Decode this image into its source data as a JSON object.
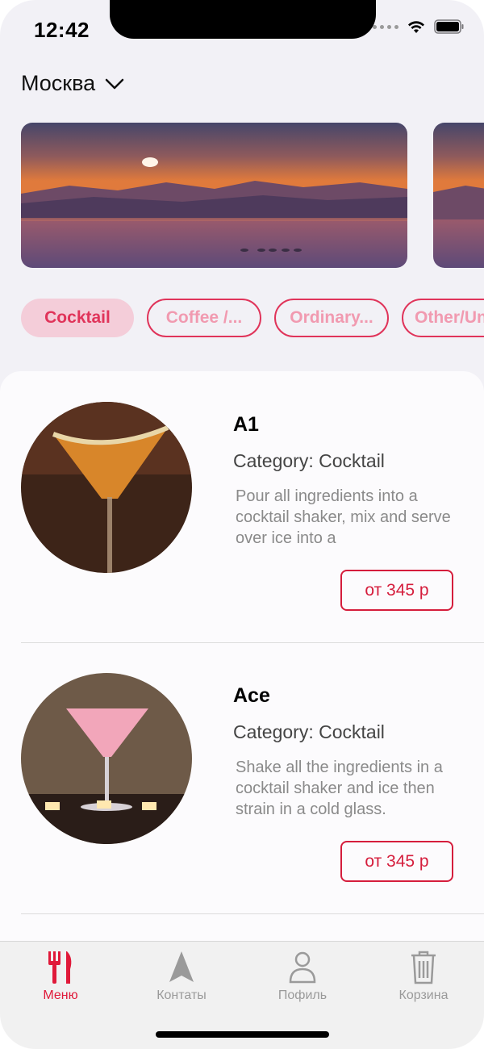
{
  "status": {
    "time": "12:42"
  },
  "location": {
    "city": "Москва"
  },
  "categories": [
    {
      "label": "Cocktail",
      "active": true
    },
    {
      "label": "Coffee /...",
      "active": false
    },
    {
      "label": "Ordinary...",
      "active": false
    },
    {
      "label": "Other/Un",
      "active": false
    }
  ],
  "items": [
    {
      "title": "A1",
      "category": "Category: Cocktail",
      "description": "Pour all ingredients into a cocktail shaker, mix and serve over ice into a",
      "price": "от 345 р"
    },
    {
      "title": "Ace",
      "category": "Category: Cocktail",
      "description": "Shake all the ingredients in a cocktail shaker and ice then strain in a cold glass.",
      "price": "от 345 р"
    }
  ],
  "tabs": [
    {
      "label": "Меню",
      "icon": "fork-knife-icon",
      "active": true
    },
    {
      "label": "Контаты",
      "icon": "navigation-arrow-icon",
      "active": false
    },
    {
      "label": "Пофиль",
      "icon": "person-icon",
      "active": false
    },
    {
      "label": "Корзина",
      "icon": "trash-icon",
      "active": false
    }
  ],
  "colors": {
    "accent": "#e01a3a",
    "chip_active_bg": "#f4cdd9",
    "chip_text": "#e0345a",
    "background": "#f2f1f6"
  }
}
